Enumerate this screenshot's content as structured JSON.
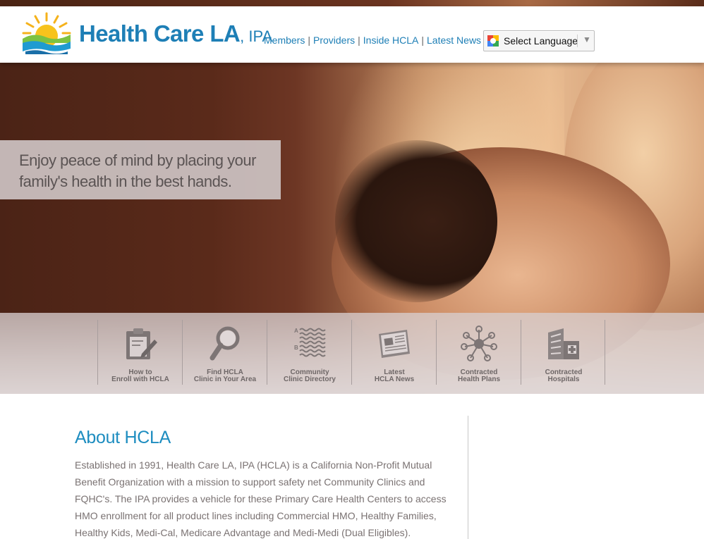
{
  "header": {
    "brand": "Health Care LA",
    "brand_suffix": ", IPA",
    "nav": [
      {
        "label": "Members"
      },
      {
        "label": "Providers"
      },
      {
        "label": "Inside HCLA"
      },
      {
        "label": "Latest News"
      }
    ],
    "separator": "|",
    "language_select": {
      "label": "Select Language",
      "arrow": "▼"
    }
  },
  "hero": {
    "tagline": "Enjoy peace of mind by placing your family's health in the best hands."
  },
  "quick_links": [
    {
      "line1": "How to",
      "line2": "Enroll with HCLA",
      "icon": "clipboard-icon"
    },
    {
      "line1": "Find HCLA",
      "line2": "Clinic in Your Area",
      "icon": "magnifier-icon"
    },
    {
      "line1": "Community",
      "line2": "Clinic Directory",
      "icon": "directory-icon",
      "letters": [
        "A",
        "B"
      ]
    },
    {
      "line1": "Latest",
      "line2": "HCLA News",
      "icon": "newspaper-icon"
    },
    {
      "line1": "Contracted",
      "line2": "Health Plans",
      "icon": "network-icon"
    },
    {
      "line1": "Contracted",
      "line2": "Hospitals",
      "icon": "hospital-icon"
    }
  ],
  "about": {
    "title": "About HCLA",
    "body": "Established in 1991, Health Care LA, IPA (HCLA) is a California Non-Profit Mutual Benefit Organization with a mission to support safety net Community Clinics and FQHC's. The IPA provides a vehicle for these Primary Care Health Centers to access HMO enrollment for all product lines including Commercial HMO, Healthy Families, Healthy Kids, Medi-Cal, Medicare Advantage and Medi-Medi (Dual Eligibles)."
  },
  "colors": {
    "brand_blue": "#1e7fb6",
    "heading_blue": "#1e8dc0",
    "body_gray": "#7a7272"
  }
}
